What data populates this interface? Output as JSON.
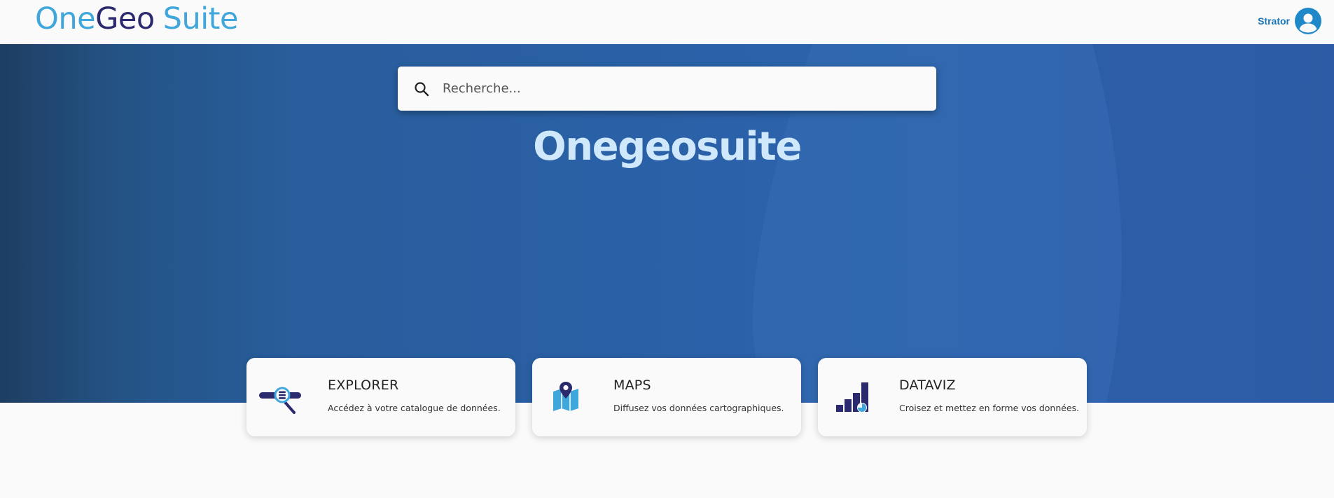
{
  "header": {
    "logo": {
      "part1": "One",
      "part2": "Geo",
      "part3": "Suite"
    },
    "user": {
      "name": "Strator",
      "icon": "account-circle-icon"
    }
  },
  "hero": {
    "search": {
      "placeholder": "Recherche...",
      "icon": "search-icon"
    },
    "title": "Onegeosuite"
  },
  "cards": [
    {
      "title": "EXPLORER",
      "description": "Accédez à votre catalogue de données.",
      "icon": "explorer-catalog-icon"
    },
    {
      "title": "MAPS",
      "description": "Diffusez vos données cartographiques.",
      "icon": "map-pin-icon"
    },
    {
      "title": "DATAVIZ",
      "description": "Croisez et mettez en forme vos données.",
      "icon": "bar-chart-icon"
    }
  ],
  "colors": {
    "brand_light": "#3fa7dc",
    "brand_dark": "#2c2a6e",
    "hero_title": "#cfe8fb",
    "user_text": "#1b75b6"
  }
}
